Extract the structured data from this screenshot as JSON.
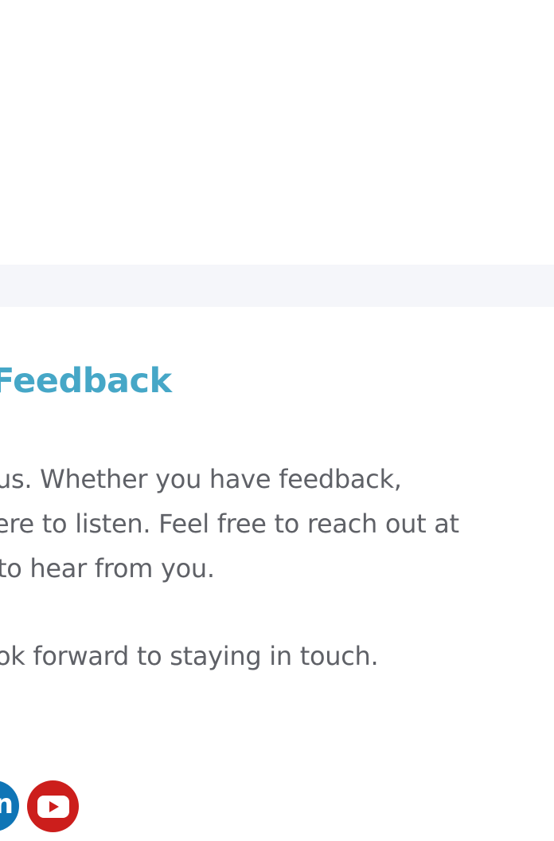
{
  "section": {
    "heading": "Feedback"
  },
  "body": {
    "line1": "us. Whether you have feedback,",
    "line2": "ere to listen. Feel free to reach out at",
    "line3": "to hear from you.",
    "line4": "ok forward to staying in touch."
  },
  "social": {
    "linkedin": {
      "icon": "linkedin-icon",
      "glyph": "in",
      "color": "#0f75b6"
    },
    "youtube": {
      "icon": "youtube-icon",
      "color": "#cc1e1c"
    }
  },
  "colors": {
    "heading": "#46a7c7",
    "body_text": "#5f6167",
    "band": "#f5f6fa"
  }
}
